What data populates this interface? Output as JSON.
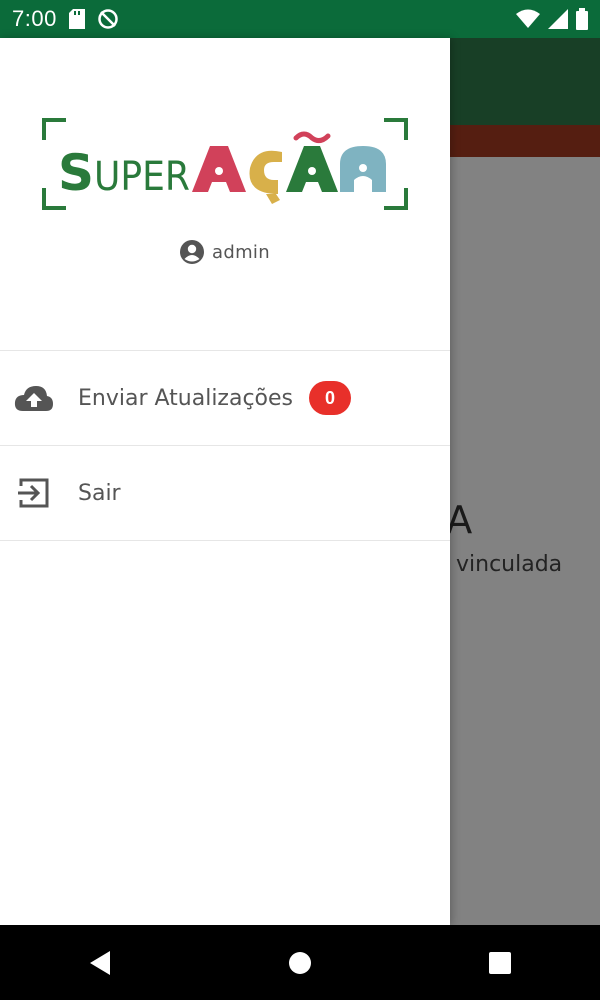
{
  "status_bar": {
    "time": "7:00",
    "icons": [
      "sd-card-icon",
      "sync-off-icon",
      "wifi-icon",
      "signal-icon",
      "battery-icon"
    ]
  },
  "app": {
    "empty_title": "AZIA",
    "empty_subtitle": "vinculada",
    "colors": {
      "toolbar": "#2e7a4a",
      "strip": "#a43a22"
    }
  },
  "drawer": {
    "logo": {
      "text": "SUPERAÇÃO",
      "colors": [
        "#2a7a3b",
        "#d1415a",
        "#d8b04a",
        "#7fb3c1"
      ]
    },
    "user": {
      "icon": "account-circle-icon",
      "name": "admin"
    },
    "menu": [
      {
        "icon": "cloud-upload-icon",
        "label": "Enviar Atualizações",
        "badge": "0"
      },
      {
        "icon": "exit-icon",
        "label": "Sair"
      }
    ]
  },
  "nav_bar": {
    "buttons": [
      "back-icon",
      "home-icon",
      "recents-icon"
    ]
  },
  "colors": {
    "status_bar": "#0b6b3a",
    "badge": "#e8302a"
  }
}
